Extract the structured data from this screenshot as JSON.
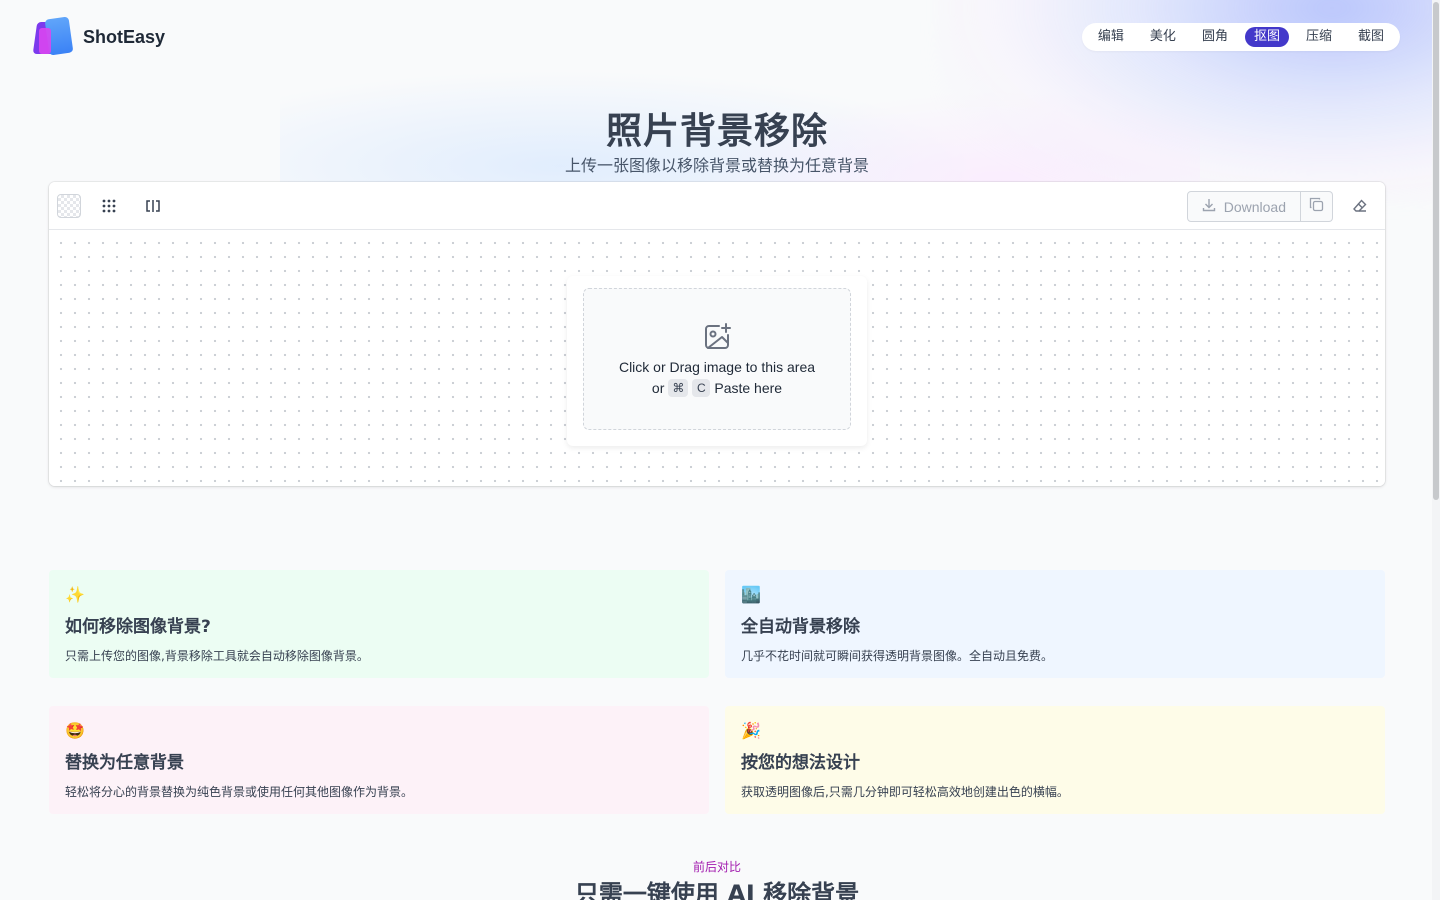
{
  "brand": {
    "name": "ShotEasy"
  },
  "nav": {
    "items": [
      {
        "label": "编辑",
        "active": false
      },
      {
        "label": "美化",
        "active": false
      },
      {
        "label": "圆角",
        "active": false
      },
      {
        "label": "抠图",
        "active": true
      },
      {
        "label": "压缩",
        "active": false
      },
      {
        "label": "截图",
        "active": false
      }
    ]
  },
  "hero": {
    "title": "照片背景移除",
    "subtitle": "上传一张图像以移除背景或替换为任意背景"
  },
  "toolbar": {
    "download_label": "Download",
    "icons": [
      "transparent-bg-icon",
      "grid-icon",
      "compare-icon",
      "download-icon",
      "copy-icon",
      "eraser-icon"
    ]
  },
  "upload": {
    "line1": "Click or Drag image to this area",
    "or_label": "or",
    "key1": "⌘",
    "key2": "C",
    "paste_label": "Paste here"
  },
  "features": [
    {
      "emoji": "✨",
      "title": "如何移除图像背景?",
      "desc": "只需上传您的图像,背景移除工具就会自动移除图像背景。"
    },
    {
      "emoji": "🏙️",
      "title": "全自动背景移除",
      "desc": "几乎不花时间就可瞬间获得透明背景图像。全自动且免费。"
    },
    {
      "emoji": "🤩",
      "title": "替换为任意背景",
      "desc": "轻松将分心的背景替换为纯色背景或使用任何其他图像作为背景。"
    },
    {
      "emoji": "🎉",
      "title": "按您的想法设计",
      "desc": "获取透明图像后,只需几分钟即可轻松高效地创建出色的横幅。"
    }
  ],
  "comparison": {
    "kicker": "前后对比",
    "title": "只需一键使用 AI 移除背景"
  },
  "colors": {
    "accent": "#4338ca",
    "kicker": "#a21caf"
  }
}
